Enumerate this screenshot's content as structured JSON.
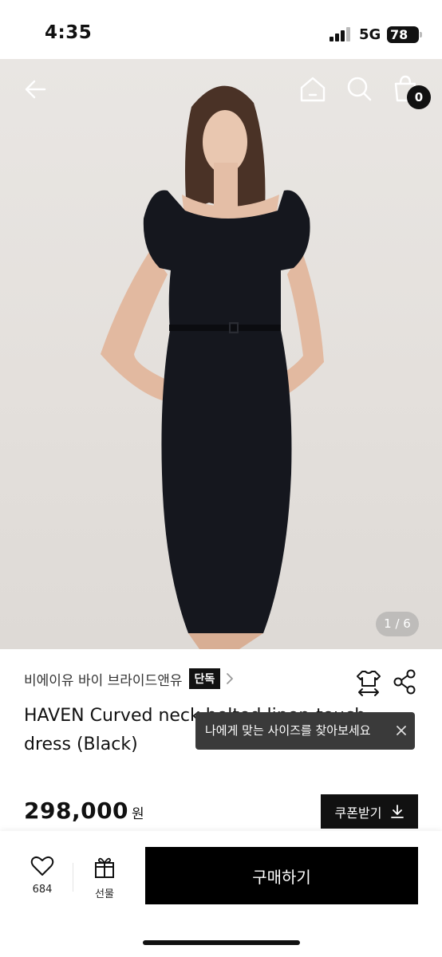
{
  "status_bar": {
    "time": "4:35",
    "network": "5G",
    "battery": "78"
  },
  "hero": {
    "page_indicator": "1 / 6",
    "cart_count": "0",
    "icons": [
      "back-arrow-icon",
      "home-icon",
      "search-icon",
      "shopping-bag-icon"
    ]
  },
  "product": {
    "brand": "비에이유 바이 브라이드앤유",
    "brand_tag": "단독",
    "title": "HAVEN Curved neck belted linen-touch dress (Black)",
    "price": "298,000",
    "price_unit": "원",
    "coupon_label": "쿠폰받기"
  },
  "tooltip": {
    "text": "나에게 맞는 사이즈를 찾아보세요"
  },
  "bottom_bar": {
    "like_count": "684",
    "gift_label": "선물",
    "buy_label": "구매하기"
  },
  "colors": {
    "primary": "#000000",
    "tooltip_bg": "#3a3a3a",
    "hero_bg": "#e6e2de"
  }
}
